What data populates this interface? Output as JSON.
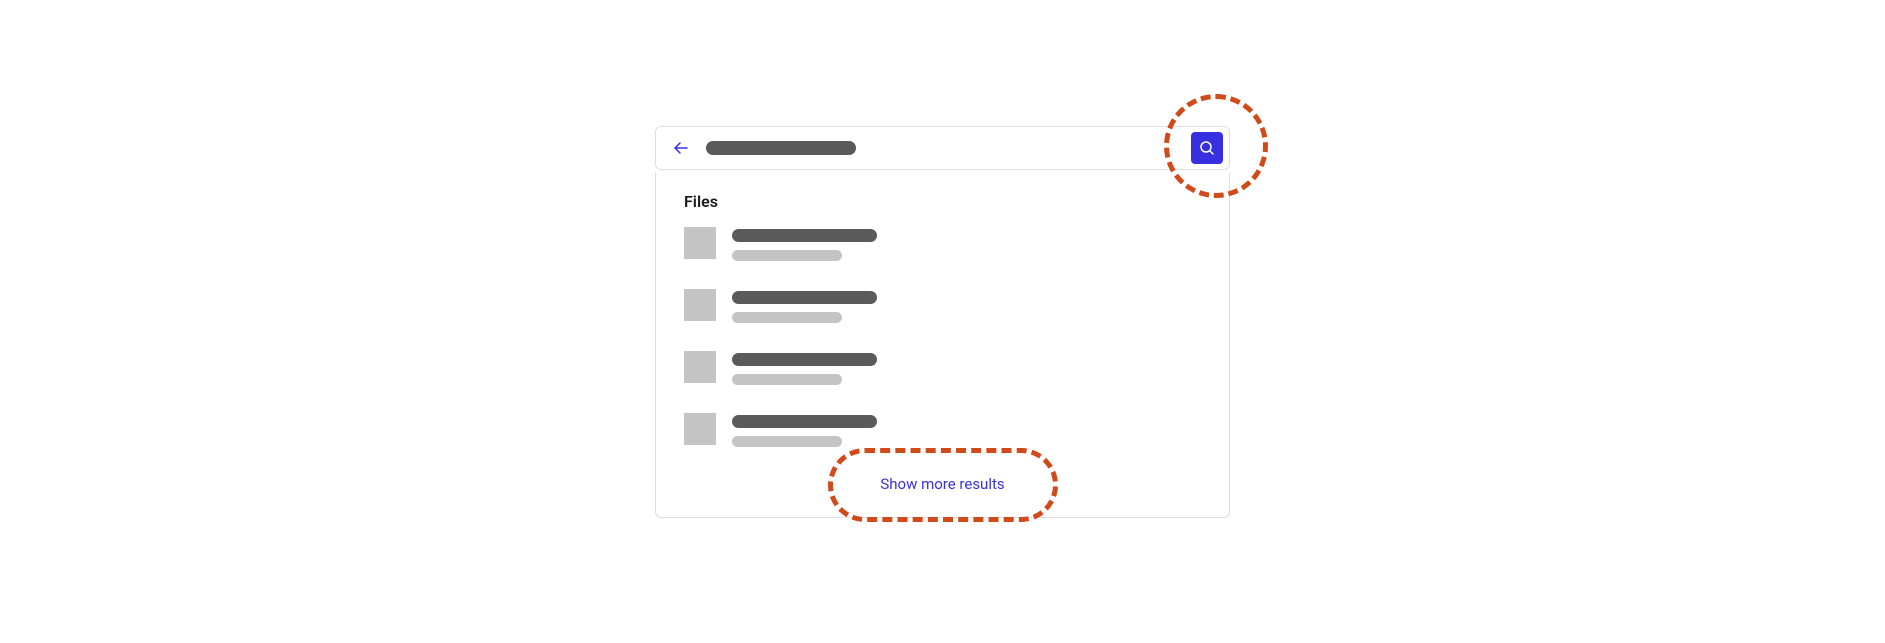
{
  "search": {
    "placeholder": ""
  },
  "results": {
    "section_header": "Files",
    "items": [
      {
        "title": "",
        "subtitle": ""
      },
      {
        "title": "",
        "subtitle": ""
      },
      {
        "title": "",
        "subtitle": ""
      },
      {
        "title": "",
        "subtitle": ""
      }
    ],
    "show_more_label": "Show more results"
  },
  "colors": {
    "accent": "#3630e0",
    "highlight": "#d04a1a"
  }
}
